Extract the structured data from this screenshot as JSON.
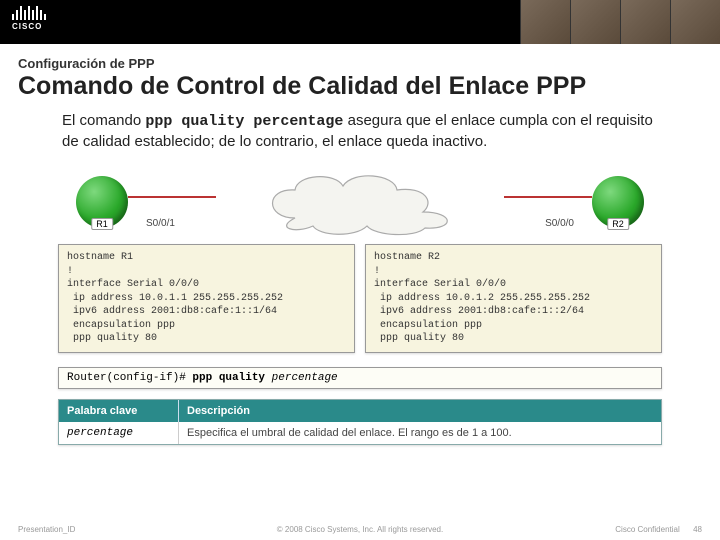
{
  "logo_text": "CISCO",
  "subtitle": "Configuración de PPP",
  "title": "Comando de Control de Calidad del Enlace PPP",
  "body_pre": "El comando ",
  "body_cmd": "ppp quality percentage",
  "body_post": " asegura que el enlace cumpla con el requisito de calidad establecido; de lo contrario, el enlace queda inactivo.",
  "router1": "R1",
  "router2": "R2",
  "iface_left": "S0/0/1",
  "iface_right": "S0/0/0",
  "cfg1": "hostname R1\n!\ninterface Serial 0/0/0\n ip address 10.0.1.1 255.255.255.252\n ipv6 address 2001:db8:cafe:1::1/64\n encapsulation ppp\n ppp quality 80",
  "cfg2": "hostname R2\n!\ninterface Serial 0/0/0\n ip address 10.0.1.2 255.255.255.252\n ipv6 address 2001:db8:cafe:1::2/64\n encapsulation ppp\n ppp quality 80",
  "cmd_prompt": "Router(config-if)# ",
  "cmd_bold": "ppp quality ",
  "cmd_param": "percentage",
  "th1": "Palabra clave",
  "th2": "Descripción",
  "td1": "percentage",
  "td2": "Especifica el umbral de calidad del enlace. El rango es de 1 a 100.",
  "footer_left": "Presentation_ID",
  "footer_center": "© 2008 Cisco Systems, Inc. All rights reserved.",
  "footer_conf": "Cisco Confidential",
  "footer_page": "48"
}
